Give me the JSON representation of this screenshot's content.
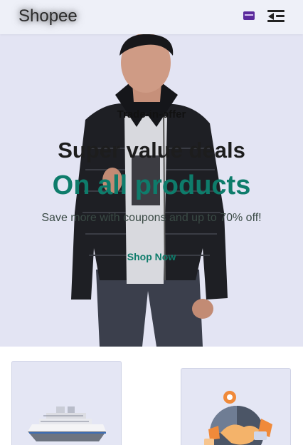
{
  "header": {
    "brand": "Shopee",
    "cart_icon": "card-icon",
    "menu_icon": "menu-collapse-icon"
  },
  "hero": {
    "eyebrow": "Trade-in-offer",
    "headline": "Super value deals",
    "subhead": "On all products",
    "description": "Save more with coupons and up to 70% off!",
    "cta_label": "Shop Now",
    "accent_color": "#0e7c6b"
  },
  "features": [
    {
      "icon": "cruise-ship-icon"
    },
    {
      "icon": "handshake-icon"
    }
  ]
}
